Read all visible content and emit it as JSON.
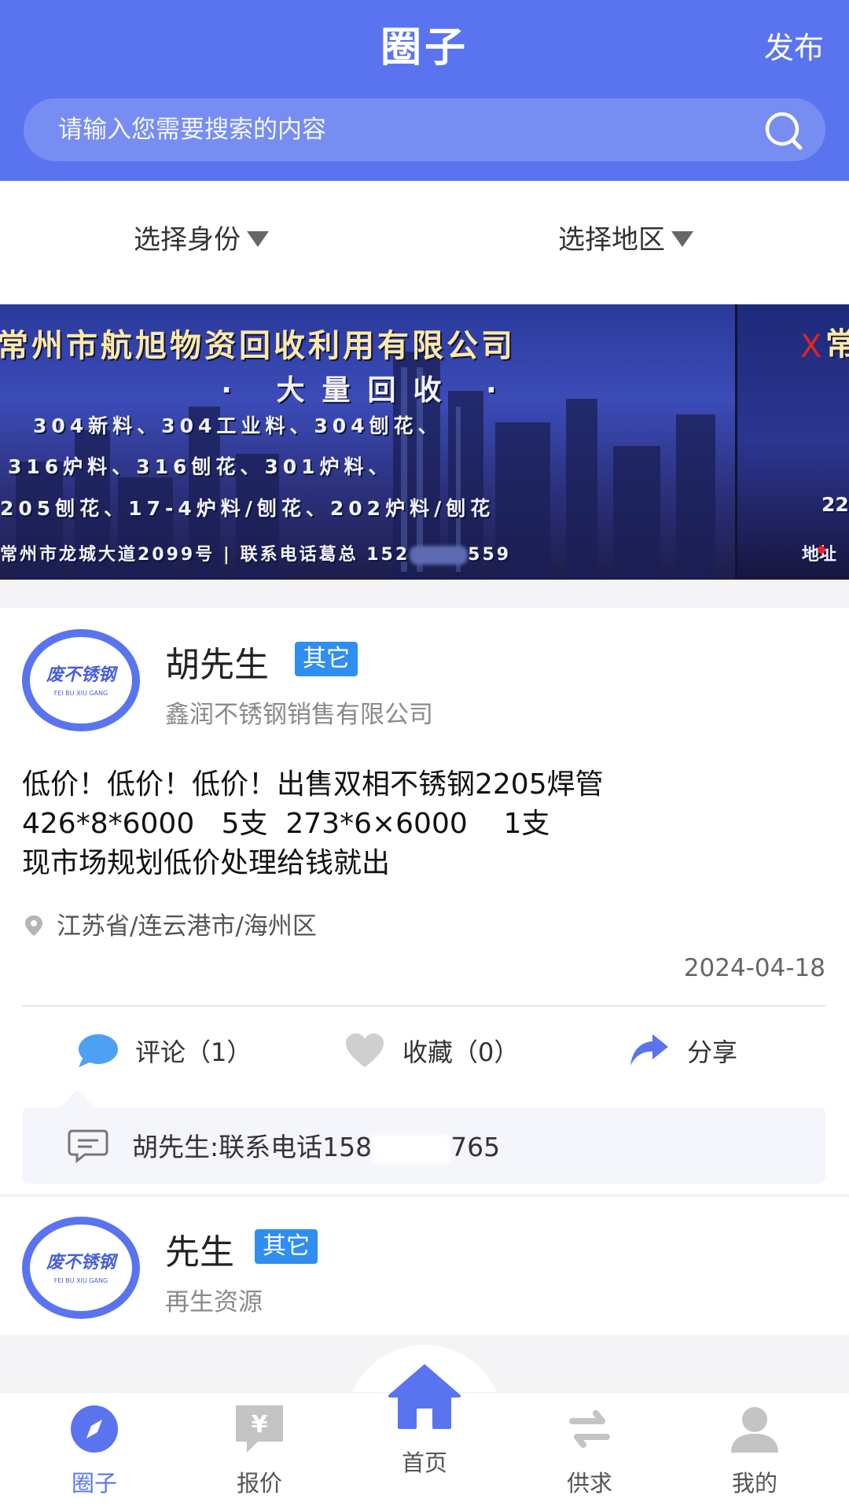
{
  "header": {
    "title": "圈子",
    "publish_label": "发布",
    "search_placeholder": "请输入您需要搜索的内容"
  },
  "filters": {
    "identity_label": "选择身份",
    "region_label": "选择地区"
  },
  "banner": {
    "company": "常州市航旭物资回收利用有限公司",
    "headline": "· 大量回收 ·",
    "line1": "304新料、304工业料、304刨花、",
    "line2": "316炉料、316刨花、301炉料、",
    "line3": "205刨花、17-4炉料/刨花、202炉料/刨花",
    "address_prefix": "常州市龙城大道2099号 | 联系电话葛总 152",
    "address_suffix": "559",
    "slide2_top": "常",
    "slide2_mid": "22",
    "slide2_bot": "地址",
    "close_label": "X"
  },
  "posts": [
    {
      "name": "胡先生",
      "badge": "其它",
      "company": "鑫润不锈钢销售有限公司",
      "body": "低价！低价！低价！出售双相不锈钢2205焊管\n426*8*6000   5支  273*6×6000    1支\n现市场规划低价处理给钱就出",
      "location": "江苏省/连云港市/海州区",
      "date": "2024-04-18",
      "comment_label": "评论（1）",
      "favorite_label": "收藏（0）",
      "share_label": "分享",
      "comment_prefix": "胡先生:联系电话158",
      "comment_suffix": "765"
    },
    {
      "name": "先生",
      "badge": "其它",
      "company": "再生资源"
    }
  ],
  "nav": {
    "circle": "圈子",
    "quote": "报价",
    "home": "首页",
    "supply": "供求",
    "mine": "我的"
  },
  "colors": {
    "primary": "#5a74f0",
    "badge": "#2f8ef0",
    "banner_close": "#e52222"
  }
}
